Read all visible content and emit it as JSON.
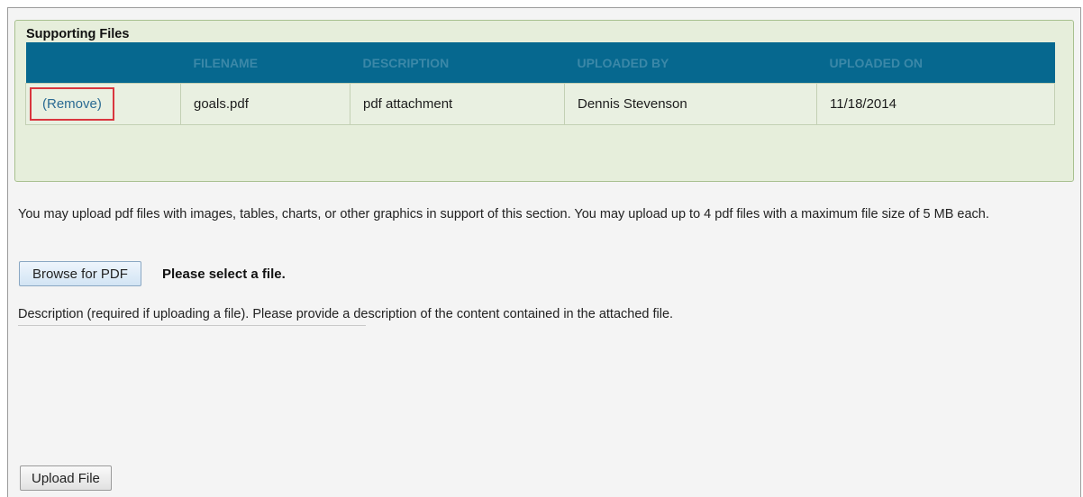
{
  "supporting_files": {
    "title": "Supporting Files",
    "columns": [
      "",
      "FILENAME",
      "DESCRIPTION",
      "UPLOADED BY",
      "UPLOADED ON"
    ],
    "rows": [
      {
        "action": "(Remove)",
        "filename": "goals.pdf",
        "description": "pdf attachment",
        "uploaded_by": "Dennis Stevenson",
        "uploaded_on": "11/18/2014"
      }
    ]
  },
  "upload": {
    "help_text": "You may upload pdf files with images, tables, charts, or other graphics in support of this section. You may upload up to 4 pdf files with a maximum file size of 5 MB each.",
    "browse_label": "Browse for PDF",
    "status": "Please select a file.",
    "description_label": "Description (required if uploading a file). Please provide a description of the content contained in the attached file.",
    "upload_label": "Upload File"
  },
  "colors": {
    "panel_bg": "#e6eedb",
    "header_bg": "#06688f",
    "highlight": "#d9363e"
  }
}
